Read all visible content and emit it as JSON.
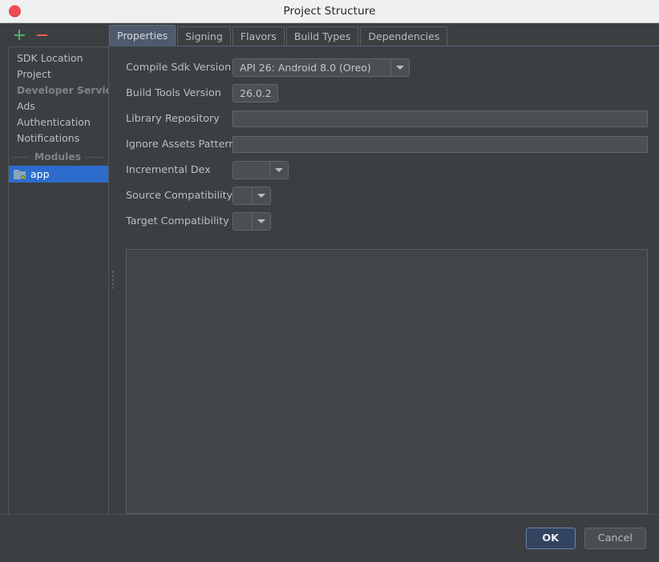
{
  "titlebar": {
    "title": "Project Structure",
    "close_icon": "close-circle-icon"
  },
  "toolbar": {
    "add_label": "+",
    "remove_label": "−",
    "add_icon": "plus-icon",
    "remove_icon": "minus-icon",
    "add_color": "#4caf69",
    "remove_color": "#e8604c"
  },
  "tabs": [
    {
      "label": "Properties",
      "active": true
    },
    {
      "label": "Signing",
      "active": false
    },
    {
      "label": "Flavors",
      "active": false
    },
    {
      "label": "Build Types",
      "active": false
    },
    {
      "label": "Dependencies",
      "active": false
    }
  ],
  "sidebar": {
    "items": [
      {
        "label": "SDK Location",
        "type": "item"
      },
      {
        "label": "Project",
        "type": "item"
      },
      {
        "label": "Developer Servic...",
        "type": "header"
      },
      {
        "label": "Ads",
        "type": "item"
      },
      {
        "label": "Authentication",
        "type": "item"
      },
      {
        "label": "Notifications",
        "type": "item"
      }
    ],
    "group_label": "Modules",
    "modules": [
      {
        "label": "app",
        "icon": "folder-icon",
        "selected": true
      }
    ]
  },
  "form": {
    "rows": [
      {
        "label": "Compile Sdk Version",
        "control": "combo",
        "value": "API 26: Android 8.0 (Oreo)"
      },
      {
        "label": "Build Tools Version",
        "control": "combo",
        "value": "26.0.2"
      },
      {
        "label": "Library Repository",
        "control": "textfield",
        "value": "",
        "placeholder": ""
      },
      {
        "label": "Ignore Assets Pattern",
        "control": "textfield",
        "value": "",
        "placeholder": ""
      },
      {
        "label": "Incremental Dex",
        "control": "combo",
        "value": ""
      },
      {
        "label": "Source Compatibility",
        "control": "combo",
        "value": ""
      },
      {
        "label": "Target Compatibility",
        "control": "combo",
        "value": ""
      }
    ]
  },
  "footer": {
    "ok_label": "OK",
    "cancel_label": "Cancel",
    "accent_color": "#33445e"
  }
}
